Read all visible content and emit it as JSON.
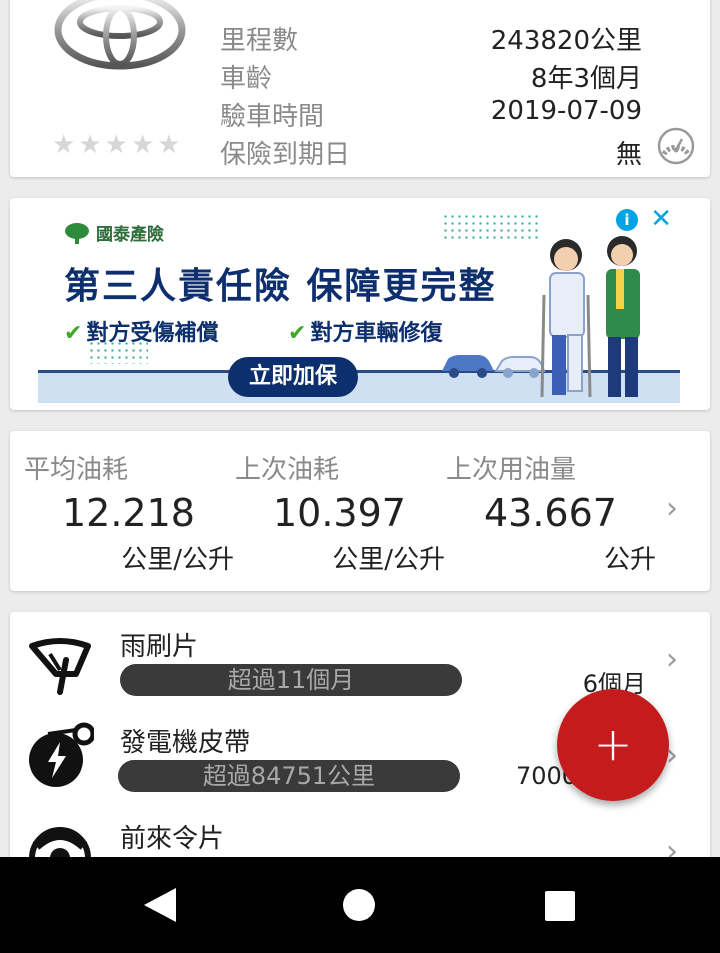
{
  "vehicle": {
    "logo_icon": "toyota-logo",
    "rating_stars": 5,
    "rating_value": 0,
    "rows": [
      {
        "label": "里程數",
        "value": "243820公里"
      },
      {
        "label": "車齡",
        "value": "8年3個月"
      },
      {
        "label": "驗車時間",
        "value": "2019-07-09"
      },
      {
        "label": "保險到期日",
        "value": "無"
      }
    ],
    "gauge_icon": "speedometer-icon"
  },
  "ad": {
    "brand": "國泰產險",
    "headline": "第三人責任險 保障更完整",
    "check1": "對方受傷補償",
    "check2": "對方車輛修復",
    "cta": "立即加保",
    "info_icon": "i",
    "close_icon": "✕",
    "colors": {
      "navy": "#0d2f6e",
      "green": "#3fa82a",
      "blue": "#00a4e4"
    }
  },
  "fuel": {
    "items": [
      {
        "label": "平均油耗",
        "value": "12.218",
        "unit": "公里/公升"
      },
      {
        "label": "上次油耗",
        "value": "10.397",
        "unit": "公里/公升"
      },
      {
        "label": "上次用油量",
        "value": "43.667",
        "unit": "公升"
      }
    ]
  },
  "maintenance": {
    "items": [
      {
        "icon": "wiper-icon",
        "title": "雨刷片",
        "status": "超過11個月",
        "interval": "6個月"
      },
      {
        "icon": "belt-icon",
        "title": "發電機皮帶",
        "status": "超過84751公里",
        "interval": "7000"
      },
      {
        "icon": "brake-pad-icon",
        "title": "前來令片",
        "status": "",
        "interval": ""
      }
    ]
  },
  "fab": {
    "label": "+",
    "color": "#c41c1c"
  },
  "navbar": {
    "back": "back-icon",
    "home": "home-icon",
    "recent": "recent-apps-icon"
  }
}
